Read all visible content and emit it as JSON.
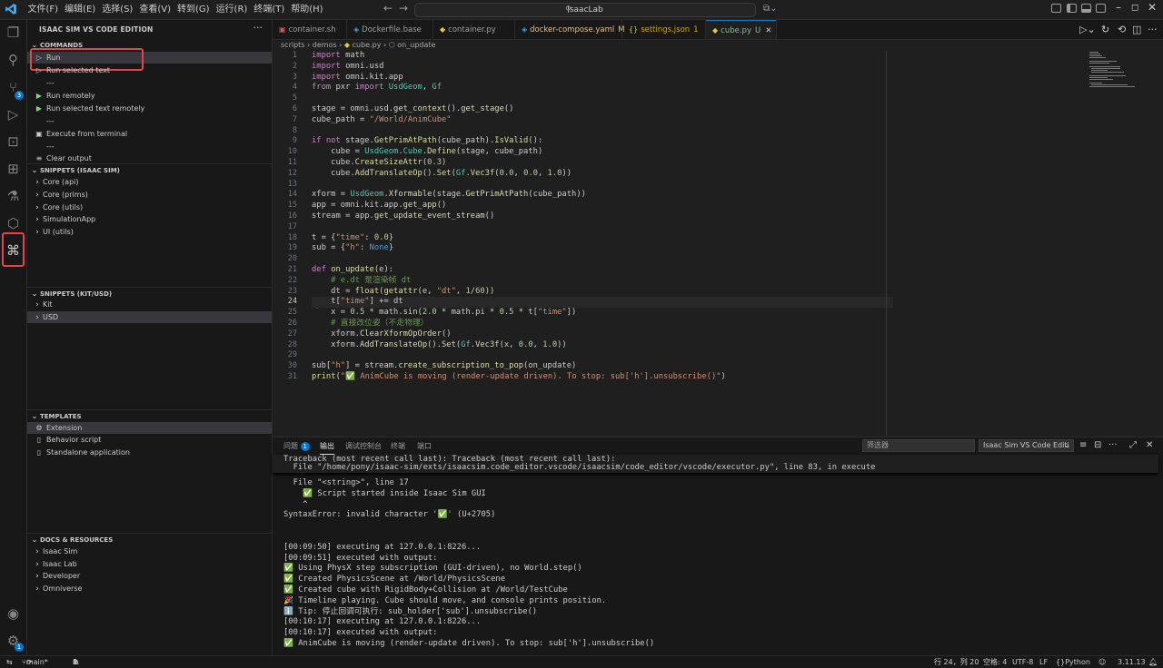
{
  "titlebar": {
    "menus": [
      "文件(F)",
      "编辑(E)",
      "选择(S)",
      "查看(V)",
      "转到(G)",
      "运行(R)",
      "终端(T)",
      "帮助(H)"
    ],
    "search": "IsaacLab"
  },
  "activity": {
    "scm_badge": "3",
    "settings_badge": "1"
  },
  "sidebar": {
    "title": "ISAAC SIM VS CODE EDITION",
    "sections": {
      "commands": "COMMANDS",
      "snippets_isaac": "SNIPPETS (ISAAC SIM)",
      "snippets_kit": "SNIPPETS (KIT/USD)",
      "templates": "TEMPLATES",
      "docs": "DOCS & RESOURCES"
    },
    "commands": [
      "Run",
      "Run selected text",
      "---",
      "Run remotely",
      "Run selected text remotely",
      "---",
      "Execute from terminal",
      "---",
      "Clear output"
    ],
    "snippets_isaac": [
      "Core (api)",
      "Core (prims)",
      "Core (utils)",
      "SimulationApp",
      "UI (utils)"
    ],
    "snippets_kit": [
      "Kit",
      "USD"
    ],
    "templates": [
      "Extension",
      "Behavior script",
      "Standalone application"
    ],
    "docs": [
      "Isaac Sim",
      "Isaac Lab",
      "Developer",
      "Omniverse"
    ]
  },
  "tabs": [
    {
      "label": "container.sh",
      "icon": "terminal-icon",
      "mod": ""
    },
    {
      "label": "Dockerfile.base",
      "icon": "docker-icon",
      "mod": ""
    },
    {
      "label": "container.py",
      "icon": "python-icon",
      "mod": ""
    },
    {
      "label": "docker-compose.yaml",
      "icon": "docker-icon",
      "mod": "M"
    },
    {
      "label": "settings.json",
      "icon": "json-icon",
      "mod": "1"
    },
    {
      "label": "cube.py",
      "icon": "python-icon",
      "mod": "U"
    }
  ],
  "breadcrumb": [
    "scripts",
    "demos",
    "cube.py",
    "on_update"
  ],
  "code": {
    "current_line": 24,
    "lines": [
      "import math",
      "import omni.usd",
      "import omni.kit.app",
      "from pxr import UsdGeom, Gf",
      "",
      "stage = omni.usd.get_context().get_stage()",
      "cube_path = \"/World/AnimCube\"",
      "",
      "if not stage.GetPrimAtPath(cube_path).IsValid():",
      "    cube = UsdGeom.Cube.Define(stage, cube_path)",
      "    cube.CreateSizeAttr(0.3)",
      "    cube.AddTranslateOp().Set(Gf.Vec3f(0.0, 0.0, 1.0))",
      "",
      "xform = UsdGeom.Xformable(stage.GetPrimAtPath(cube_path))",
      "app = omni.kit.app.get_app()",
      "stream = app.get_update_event_stream()",
      "",
      "t = {\"time\": 0.0}",
      "sub = {\"h\": None}",
      "",
      "def on_update(e):",
      "    # e.dt 是渲染帧 dt",
      "    dt = float(getattr(e, \"dt\", 1/60))",
      "    t[\"time\"] += dt",
      "    x = 0.5 * math.sin(2.0 * math.pi * 0.5 * t[\"time\"])",
      "    # 直接改位姿（不走物理）",
      "    xform.ClearXformOpOrder()",
      "    xform.AddTranslateOp().Set(Gf.Vec3f(x, 0.0, 1.0))",
      "",
      "sub[\"h\"] = stream.create_subscription_to_pop(on_update)",
      "print(\"✅ AnimCube is moving (render-update driven). To stop: sub['h'].unsubscribe()\")"
    ]
  },
  "panel": {
    "tabs": [
      "问题",
      "输出",
      "调试控制台",
      "终端",
      "端口"
    ],
    "problems_badge": "1",
    "active_tab": "输出",
    "filter_placeholder": "筛选器",
    "channel": "Isaac Sim VS Code Editi",
    "sticky": [
      "Traceback (most recent call last): Traceback (most recent call last):",
      "  File \"/home/pony/isaac-sim/exts/isaacsim.code_editor.vscode/isaacsim/code_editor/vscode/executor.py\", line 83, in execute"
    ],
    "output": [
      "  File \"<string>\", line 17",
      "    ✅ Script started inside Isaac Sim GUI",
      "    ^",
      "SyntaxError: invalid character '✅' (U+2705)",
      "",
      "",
      "[00:09:50] executing at 127.0.0.1:8226...",
      "[00:09:51] executed with output:",
      "✅ Using PhysX step subscription (GUI-driven), no World.step()",
      "✅ Created PhysicsScene at /World/PhysicsScene",
      "✅ Created cube with RigidBody+Collision at /World/TestCube",
      "🎉 Timeline playing. Cube should move, and console prints position.",
      "ℹ️ Tip: 停止回调可执行: sub_holder['sub'].unsubscribe()",
      "[00:10:17] executing at 127.0.0.1:8226...",
      "[00:10:17] executed with output:",
      "✅ AnimCube is moving (render-update driven). To stop: sub['h'].unsubscribe()"
    ]
  },
  "status": {
    "branch": "main*",
    "errors": "0",
    "warnings": "1",
    "position": "行 24，列 20",
    "spaces": "空格: 4",
    "encoding": "UTF-8",
    "eol": "LF",
    "language": "Python",
    "version": "3.11.13"
  }
}
